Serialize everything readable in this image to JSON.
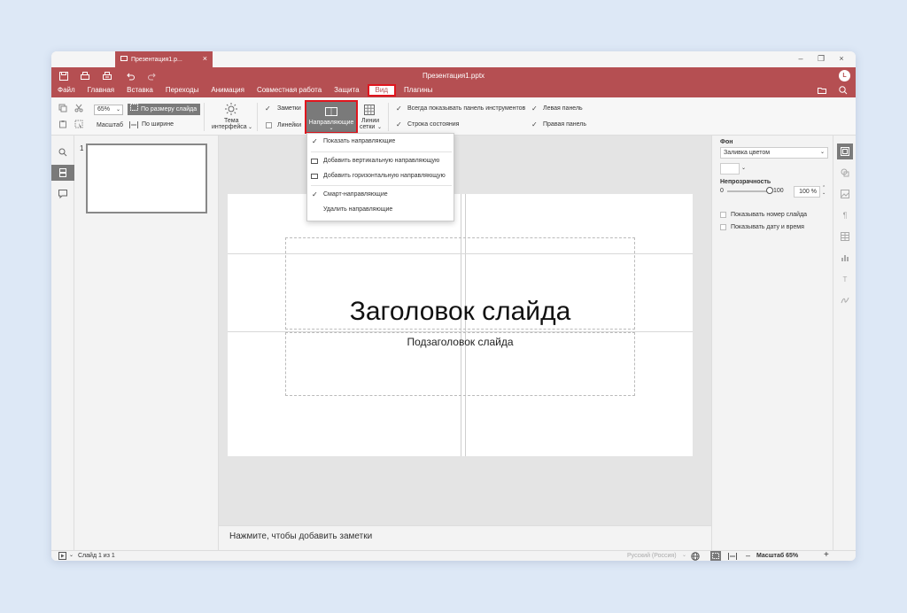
{
  "window": {
    "doc_tab_label": "Презентация1.p...",
    "title": "Презентация1.pptx",
    "user_initial": "L"
  },
  "menu": [
    {
      "label": "Файл",
      "active": false
    },
    {
      "label": "Главная",
      "active": false
    },
    {
      "label": "Вставка",
      "active": false
    },
    {
      "label": "Переходы",
      "active": false
    },
    {
      "label": "Анимация",
      "active": false
    },
    {
      "label": "Совместная работа",
      "active": false
    },
    {
      "label": "Защита",
      "active": false
    },
    {
      "label": "Вид",
      "active": true
    },
    {
      "label": "Плагины",
      "active": false
    }
  ],
  "toolbar": {
    "zoom_value": "65%",
    "fit_slide": "По размеру слайда",
    "zoom_label": "Масштаб",
    "fit_width": "По ширине",
    "theme_line1": "Тема",
    "theme_line2": "интерфейса",
    "notes": "Заметки",
    "rulers": "Линейки",
    "guides_label": "Направляющие",
    "gridlines_line1": "Линии",
    "gridlines_line2": "сетки",
    "always_show_toolbar": "Всегда показывать панель инструментов",
    "status_bar": "Строка состояния",
    "left_panel": "Левая панель",
    "right_panel": "Правая панель"
  },
  "guides_menu": {
    "show_guides": "Показать направляющие",
    "add_vertical": "Добавить вертикальную направляющую",
    "add_horizontal": "Добавить горизонтальную направляющую",
    "smart_guides": "Смарт-направляющие",
    "remove_guides": "Удалить направляющие"
  },
  "thumbnails": {
    "slide_number": "1"
  },
  "slide": {
    "title": "Заголовок слайда",
    "subtitle": "Подзаголовок слайда"
  },
  "notes_placeholder": "Нажмите, чтобы добавить заметки",
  "right_panel": {
    "background_label": "Фон",
    "fill_value": "Заливка цветом",
    "opacity_label": "Непрозрачность",
    "opacity_min": "0",
    "opacity_max": "100",
    "opacity_value": "100 %",
    "opacity_fraction": 1.0,
    "show_slide_number": "Показывать номер слайда",
    "show_date_time": "Показывать дату и время"
  },
  "statusbar": {
    "slide_counter": "Слайд 1 из 1",
    "language": "Русский (Россия)",
    "zoom_text": "Масштаб 65%"
  },
  "colors": {
    "brand": "#b54f52",
    "highlight": "#e0161e",
    "active_button": "#7a7a7a"
  }
}
